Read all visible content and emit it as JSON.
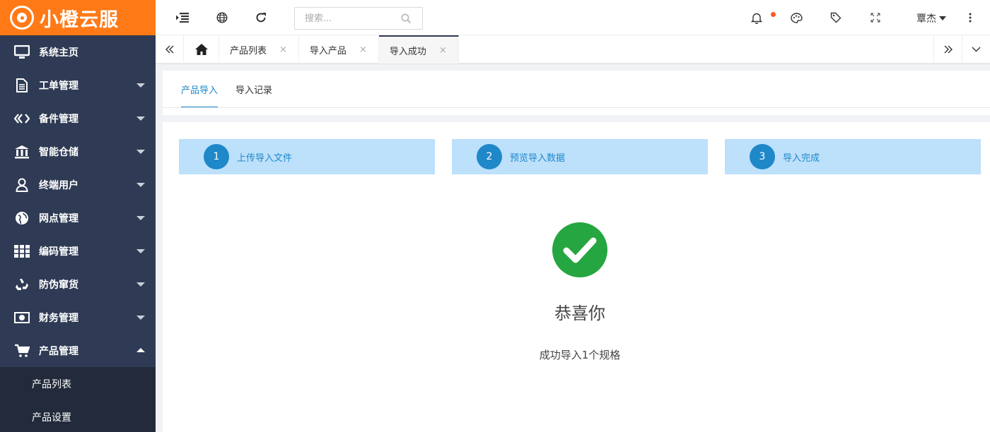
{
  "brand": {
    "name": "小橙云服"
  },
  "sidebar": {
    "items": [
      {
        "label": "系统主页",
        "icon": "monitor-icon"
      },
      {
        "label": "工单管理",
        "icon": "document-icon"
      },
      {
        "label": "备件管理",
        "icon": "parts-icon"
      },
      {
        "label": "智能仓储",
        "icon": "warehouse-icon"
      },
      {
        "label": "终端用户",
        "icon": "user-icon"
      },
      {
        "label": "网点管理",
        "icon": "globe-icon"
      },
      {
        "label": "编码管理",
        "icon": "grid-icon"
      },
      {
        "label": "防伪窜货",
        "icon": "recycle-icon"
      },
      {
        "label": "财务管理",
        "icon": "money-icon"
      },
      {
        "label": "产品管理",
        "icon": "cart-icon"
      }
    ],
    "subitems": [
      {
        "label": "产品列表"
      },
      {
        "label": "产品设置"
      }
    ]
  },
  "topbar": {
    "search_placeholder": "搜索...",
    "user_name": "覃杰"
  },
  "tabs": [
    {
      "label": "产品列表",
      "close": "×"
    },
    {
      "label": "导入产品",
      "close": "×"
    },
    {
      "label": "导入成功",
      "close": "×"
    }
  ],
  "subtabs": [
    {
      "label": "产品导入"
    },
    {
      "label": "导入记录"
    }
  ],
  "steps": [
    {
      "num": "1",
      "label": "上传导入文件"
    },
    {
      "num": "2",
      "label": "预览导入数据"
    },
    {
      "num": "3",
      "label": "导入完成"
    }
  ],
  "result": {
    "title": "恭喜你",
    "message": "成功导入1个规格"
  },
  "colors": {
    "brand_orange": "#ff7a17",
    "sidebar_bg": "#2f3b54",
    "accent_blue": "#1e88c9",
    "step_bg": "#bde0fb",
    "success_green": "#25a640",
    "notice_dot": "#ff5722"
  }
}
